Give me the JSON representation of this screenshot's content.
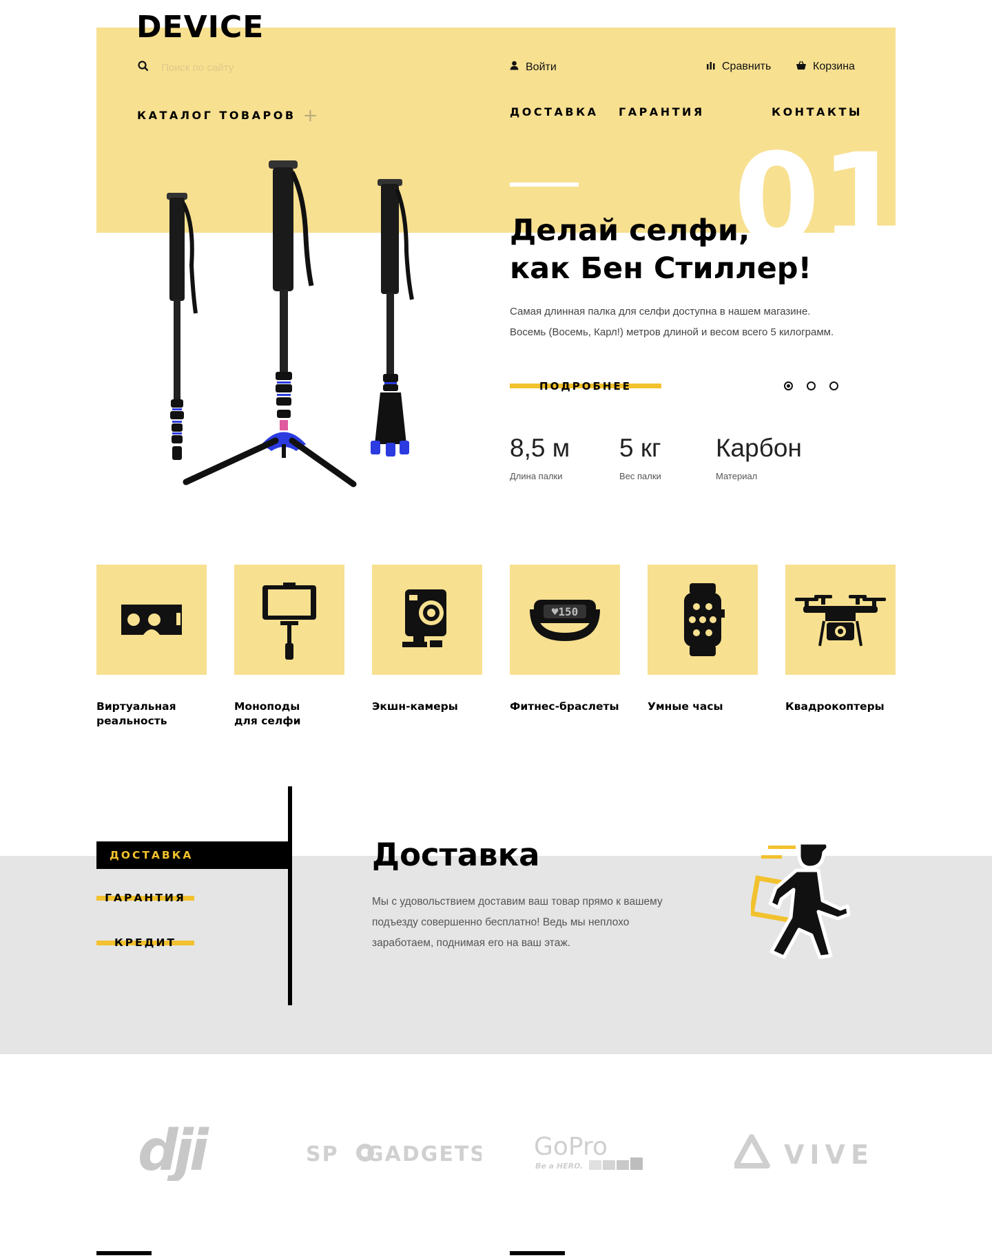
{
  "header": {
    "logo": "DEVICE",
    "search_placeholder": "Поиск по сайту",
    "login": "Войти",
    "compare": "Сравнить",
    "cart": "Корзина"
  },
  "nav": {
    "catalog": "КАТАЛОГ ТОВАРОВ",
    "delivery": "ДОСТАВКА",
    "warranty": "ГАРАНТИЯ",
    "contacts": "КОНТАКТЫ"
  },
  "slider": {
    "number": "01",
    "title_line1": "Делай селфи,",
    "title_line2": "как Бен Стиллер!",
    "desc_line1": "Самая длинная палка для селфи доступна в нашем магазине.",
    "desc_line2": "Восемь (Восемь, Карл!) метров длиной и весом всего 5 килограмм.",
    "more_button": "ПОДРОБНЕЕ",
    "active_slide": 1,
    "slide_count": 3,
    "stats": [
      {
        "value": "8,5 м",
        "label": "Длина палки"
      },
      {
        "value": "5 кг",
        "label": "Вес палки"
      },
      {
        "value": "Карбон",
        "label": "Материал"
      }
    ]
  },
  "categories": [
    {
      "name": "Виртуальная\nреальность",
      "icon": "vr-headset-icon"
    },
    {
      "name": "Моноподы\nдля селфи",
      "icon": "selfie-stick-icon"
    },
    {
      "name": "Экшн-камеры",
      "icon": "action-camera-icon"
    },
    {
      "name": "Фитнес-браслеты",
      "icon": "fitness-band-icon"
    },
    {
      "name": "Умные часы",
      "icon": "smart-watch-icon"
    },
    {
      "name": "Квадрокоптеры",
      "icon": "drone-icon"
    }
  ],
  "services": {
    "tabs": [
      "ДОСТАВКА",
      "ГАРАНТИЯ",
      "КРЕДИТ"
    ],
    "active_tab": 0,
    "title": "Доставка",
    "text_line1": "Мы с удовольствием доставим ваш товар прямо к вашему",
    "text_line2": "подъезду совершенно бесплатно! Ведь мы неплохо",
    "text_line3": "заработаем, поднимая его на ваш этаж."
  },
  "brands": {
    "dji": "dji",
    "spgadgets_left": "SP",
    "spgadgets_right": "GADGETS",
    "gopro": "GoPro",
    "gopro_tagline": "Be a HERO.",
    "vive": "VIVE"
  },
  "colors": {
    "accent_yellow": "#f7e090",
    "button_yellow": "#f2c12e",
    "service_bg": "#e5e5e5",
    "dark": "#000000"
  }
}
